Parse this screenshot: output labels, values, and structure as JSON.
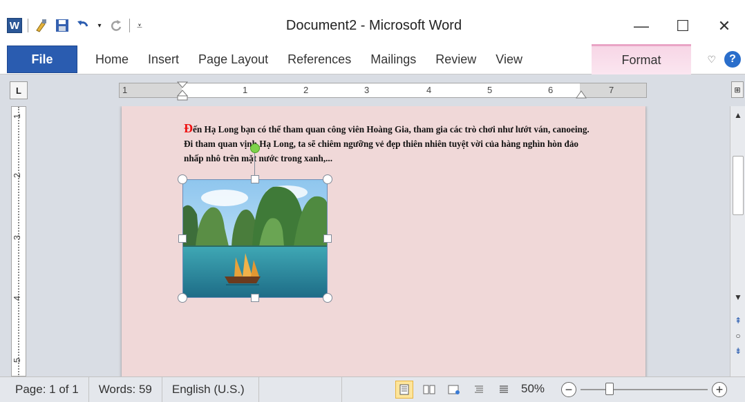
{
  "window": {
    "title": "Document2 - Microsoft Word",
    "word_icon_label": "W",
    "minimize": "—",
    "maximize": "☐",
    "close": "✕"
  },
  "ribbon": {
    "file_tab": "File",
    "tabs": [
      "Home",
      "Insert",
      "Page Layout",
      "References",
      "Mailings",
      "Review",
      "View"
    ],
    "contextual_tab": "Format",
    "help": "?"
  },
  "ruler": {
    "tab_selector": "L",
    "h_numbers": [
      "1",
      "1",
      "2",
      "3",
      "4",
      "5",
      "6",
      "7"
    ],
    "v_numbers": [
      "1",
      "2",
      "3",
      "4",
      "5"
    ]
  },
  "document": {
    "dropcap": "Đ",
    "paragraph": "ến Hạ Long bạn có thể tham quan công viên Hoàng Gia, tham gia các trò chơi như lướt ván, canoeing. Đi tham quan vịnh Hạ Long, ta sẽ chiêm ngưỡng vẻ đẹp thiên nhiên tuyệt vời của hàng nghìn hòn đảo nhấp nhô trên mặt nước trong xanh,..."
  },
  "status_bar": {
    "page": "Page: 1 of 1",
    "words": "Words: 59",
    "language": "English (U.S.)",
    "zoom": "50%"
  },
  "colors": {
    "file_tab": "#2a5cb0",
    "format_tab": "#f7d6e6",
    "page_bg": "#f0d8d8",
    "dropcap": "#e11111",
    "rotate_handle": "#7ed24a"
  }
}
